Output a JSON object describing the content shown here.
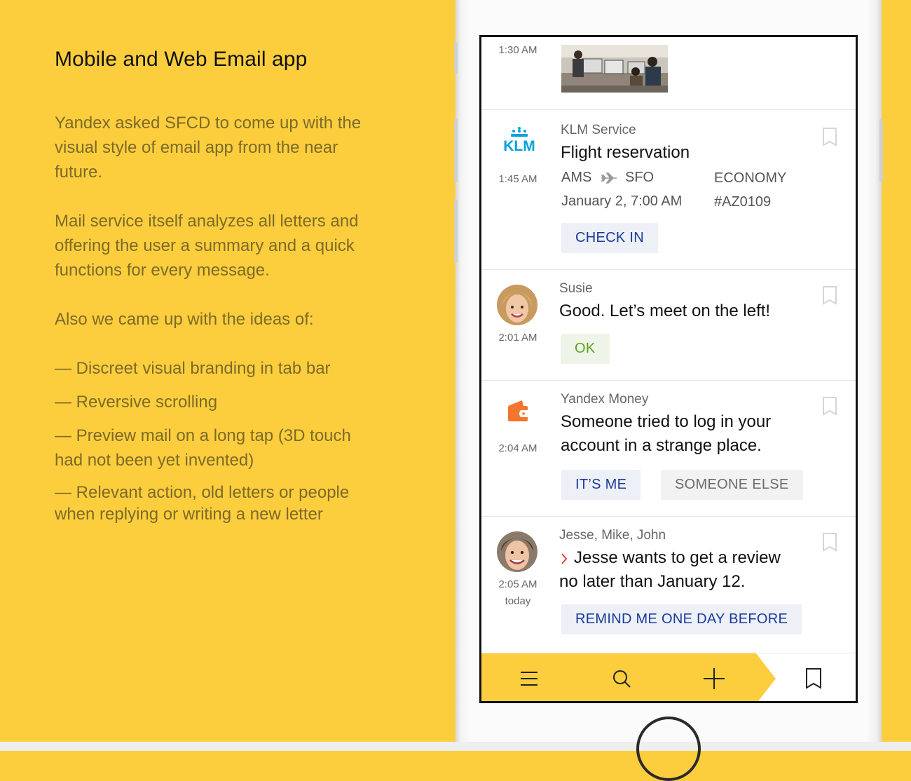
{
  "description": {
    "title": "Mobile and Web Email app",
    "para1": "Yandex asked SFCD to come up with the visual style of email app from the near future.",
    "para2": "Mail service itself analyzes all letters and offering the user a summary and a quick functions for every message.",
    "para3": "Also we came up with the ideas of:",
    "ideas": [
      "— Discreet visual branding in tab bar",
      "— Reversive scrolling",
      "— Preview mail on a long tap (3D touch had not been yet invented)",
      "— Relevant action, old letters or people when replying or writing a new letter"
    ]
  },
  "mails": [
    {
      "time": "1:30 AM",
      "thumbnail": "office-photo"
    },
    {
      "logo": "KLM",
      "sender": "KLM Service",
      "subject": "Flight reservation",
      "time": "1:45 AM",
      "from": "AMS",
      "to": "SFO",
      "class": "ECONOMY",
      "date": "January 2, 7:00 AM",
      "booking": "#AZ0109",
      "action": "CHECK IN"
    },
    {
      "sender": "Susie",
      "subject": "Good. Let’s meet on the left!",
      "time": "2:01 AM",
      "action": "OK"
    },
    {
      "sender": "Yandex Money",
      "subject_line1": "Someone tried to log in your",
      "subject_line2": "account in a strange place.",
      "time": "2:04 AM",
      "action_primary": "IT’S ME",
      "action_secondary": "SOMEONE ELSE"
    },
    {
      "sender": "Jesse, Mike, John",
      "subject_line1": "Jesse wants to get a review",
      "subject_line2": "no later than January 12.",
      "time": "2:05 AM",
      "time_day": "today",
      "action": "REMIND ME ONE DAY BEFORE"
    }
  ],
  "tabbar": {
    "tabs": [
      "menu-icon",
      "search-icon",
      "plus-icon",
      "bookmark-icon"
    ],
    "brand_color": "#FCCE3E"
  },
  "colors": {
    "background": "#FCCE3E",
    "accent_blue": "#1a3a9a",
    "ok_green": "#5aa31e",
    "klm_blue": "#00a1de",
    "yandex_money_orange": "#f2762e"
  }
}
